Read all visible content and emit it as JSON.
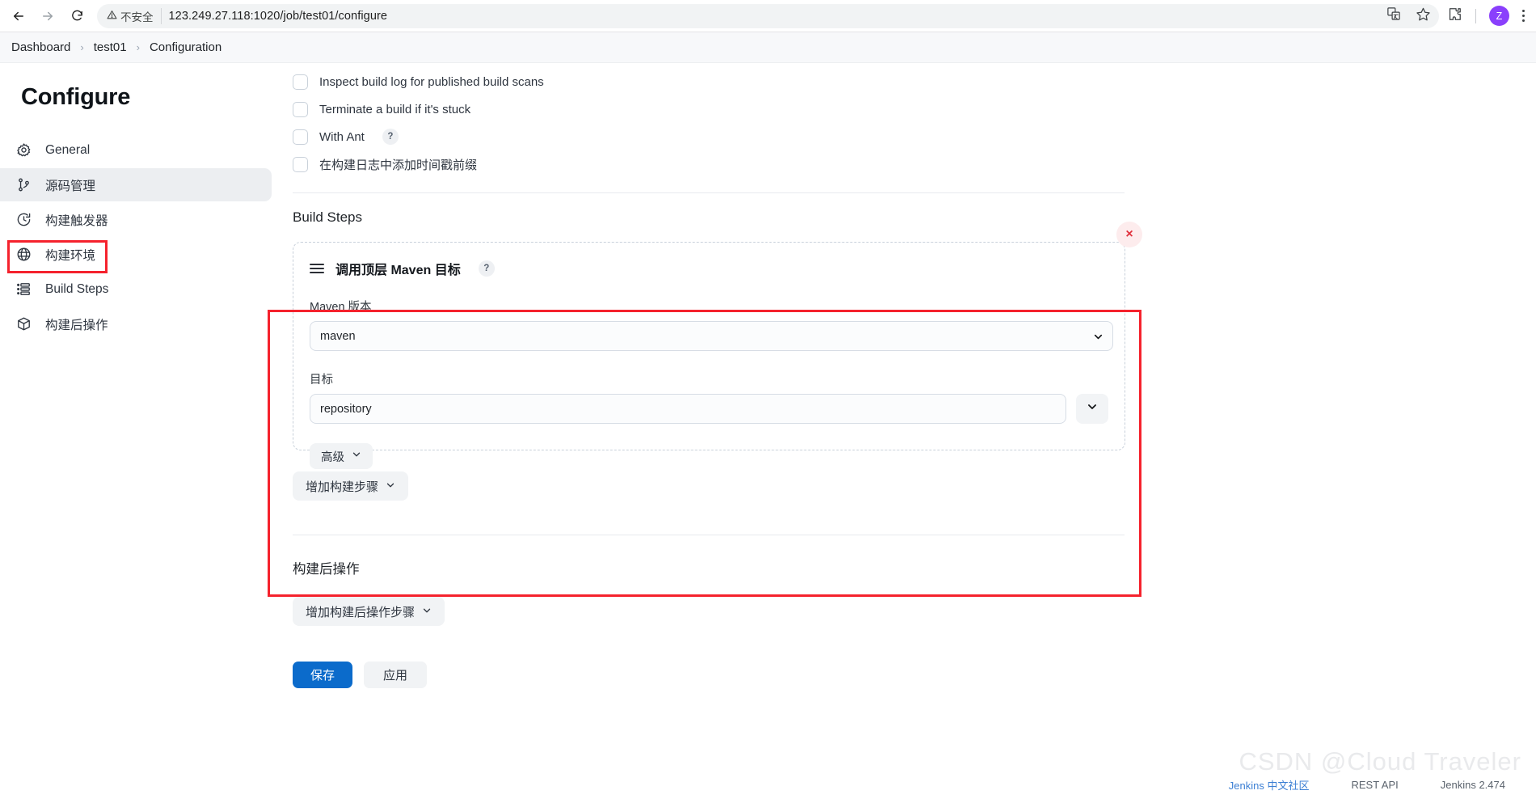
{
  "browser": {
    "back_icon": "back-arrow-icon",
    "forward_icon": "forward-arrow-icon",
    "reload_icon": "reload-icon",
    "security_label": "不安全",
    "url": "123.249.27.118:1020/job/test01/configure",
    "translate_icon": "translate-icon",
    "bookmark_icon": "star-icon",
    "extensions_icon": "puzzle-icon",
    "profile_initial": "Z",
    "menu_icon": "kebab-menu-icon"
  },
  "breadcrumb": {
    "items": [
      {
        "label": "Dashboard"
      },
      {
        "label": "test01"
      },
      {
        "label": "Configuration"
      }
    ],
    "separator": "›"
  },
  "sidebar": {
    "title": "Configure",
    "items": [
      {
        "label": "General",
        "icon": "gear-icon",
        "active": false
      },
      {
        "label": "源码管理",
        "icon": "source-branch-icon",
        "active": true
      },
      {
        "label": "构建触发器",
        "icon": "clock-icon",
        "active": false
      },
      {
        "label": "构建环境",
        "icon": "globe-icon",
        "active": false
      },
      {
        "label": "Build Steps",
        "icon": "list-steps-icon",
        "active": false
      },
      {
        "label": "构建后操作",
        "icon": "package-icon",
        "active": false
      }
    ]
  },
  "main": {
    "checkboxes": [
      {
        "label": "Inspect build log for published build scans",
        "checked": false,
        "help": false
      },
      {
        "label": "Terminate a build if it's stuck",
        "checked": false,
        "help": false
      },
      {
        "label": "With Ant",
        "checked": false,
        "help": true
      },
      {
        "label": "在构建日志中添加时间戳前缀",
        "checked": false,
        "help": false
      }
    ],
    "help_badge": "?",
    "build_steps": {
      "section_title": "Build Steps",
      "step": {
        "drag_handle_icon": "drag-handle-icon",
        "title": "调用顶层 Maven 目标",
        "help": "?",
        "delete_icon": "×",
        "maven_version_label": "Maven 版本",
        "maven_version_value": "maven",
        "goals_label": "目标",
        "goals_value": "repository",
        "goals_dropdown_icon": "chevron-down-icon",
        "advanced_label": "高级",
        "advanced_caret": "chevron-down-icon"
      },
      "add_step_label": "增加构建步骤",
      "add_step_caret": "chevron-down-icon"
    },
    "post_build": {
      "section_title": "构建后操作",
      "add_label": "增加构建后操作步骤",
      "add_caret": "chevron-down-icon"
    },
    "actions": {
      "save_label": "保存",
      "apply_label": "应用"
    }
  },
  "footer": {
    "community_link": "Jenkins 中文社区",
    "rest_api": "REST API",
    "version": "Jenkins 2.474",
    "watermark": "CSDN @Cloud Traveler"
  },
  "colors": {
    "accent": "#0b6bcb",
    "annotation": "#f5222d",
    "link": "#3c7fd4",
    "danger": "#e0303c"
  }
}
